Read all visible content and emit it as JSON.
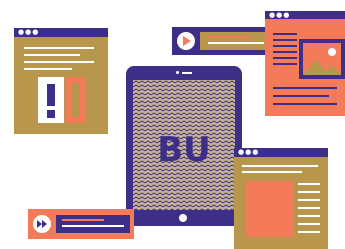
{
  "colors": {
    "navy": "#3d2f87",
    "tan": "#b8974c",
    "orange": "#f47b5a",
    "white": "#ffffff",
    "zigzag_light": "#c9b592",
    "zigzag_dark": "#3d2f87"
  },
  "tablet": {
    "logo_text": "BU",
    "home_button_icon": "circle-icon"
  },
  "windows": {
    "top_left": {
      "dots_icon": "three-dots-icon",
      "icon": "exclamation-icon"
    },
    "top_mid_player": {
      "icon": "play-icon"
    },
    "top_right": {
      "dots_icon": "three-dots-icon",
      "icon": "image-icon"
    },
    "bottom_right": {
      "dots_icon": "three-dots-icon"
    },
    "bottom_left_player": {
      "icon": "fast-forward-icon"
    }
  }
}
